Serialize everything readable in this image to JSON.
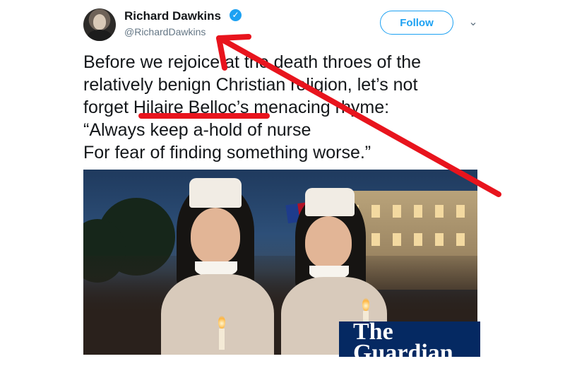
{
  "tweet": {
    "author_name": "Richard Dawkins",
    "author_handle": "@RichardDawkins",
    "verified_glyph": "✓",
    "follow_label": "Follow",
    "menu_glyph": "⌄",
    "text_lines": [
      "Before we rejoice at the death throes of the",
      "relatively benign Christian religion, let’s not",
      "forget Hilaire Belloc’s menacing rhyme:",
      "“Always keep a-hold of nurse",
      "For fear of finding something worse.”"
    ],
    "image": {
      "alt": "Two nuns holding candles at a night vigil",
      "watermark_line1": "The",
      "watermark_line2": "Guardian"
    }
  },
  "annotations": {
    "color": "#e8141d",
    "arrow": "red-arrow-icon",
    "underline": "red-underline"
  },
  "colors": {
    "brand_blue": "#1da1f2",
    "text": "#14171a",
    "secondary": "#657786",
    "guardian_navy": "#052962"
  }
}
